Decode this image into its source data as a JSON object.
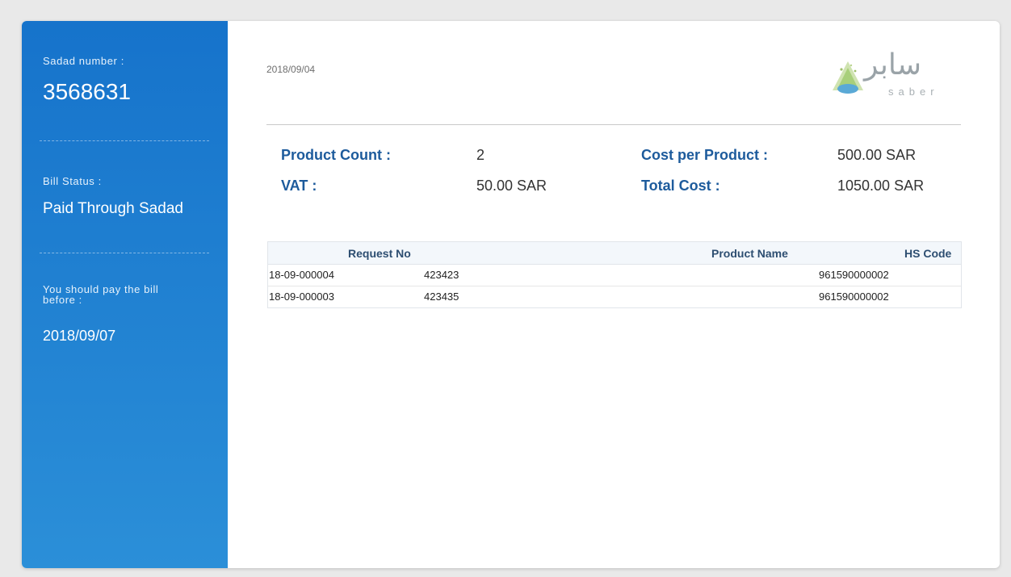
{
  "sidebar": {
    "sadad_label": "Sadad number :",
    "sadad_number": "3568631",
    "status_label": "Bill Status :",
    "status_value": "Paid Through Sadad",
    "due_label_line1": "You should pay the bill",
    "due_label_line2": "before :",
    "due_date": "2018/09/07"
  },
  "header": {
    "date": "2018/09/04",
    "logo_arabic": "سابر",
    "logo_latin": "saber"
  },
  "summary": {
    "product_count_label": "Product Count :",
    "product_count_value": "2",
    "cost_per_product_label": "Cost per Product :",
    "cost_per_product_value": "500.00 SAR",
    "vat_label": "VAT :",
    "vat_value": "50.00 SAR",
    "total_cost_label": "Total Cost :",
    "total_cost_value": "1050.00 SAR"
  },
  "table": {
    "headers": [
      "Request No",
      "Product Name",
      "HS Code"
    ],
    "rows": [
      [
        "18-09-000004",
        "423423",
        "961590000002"
      ],
      [
        "18-09-000003",
        "423435",
        "961590000002"
      ]
    ]
  },
  "colors": {
    "sidebar_top": "#1673cb",
    "sidebar_bottom": "#2b8fd8",
    "label_blue": "#1d5b9c"
  }
}
